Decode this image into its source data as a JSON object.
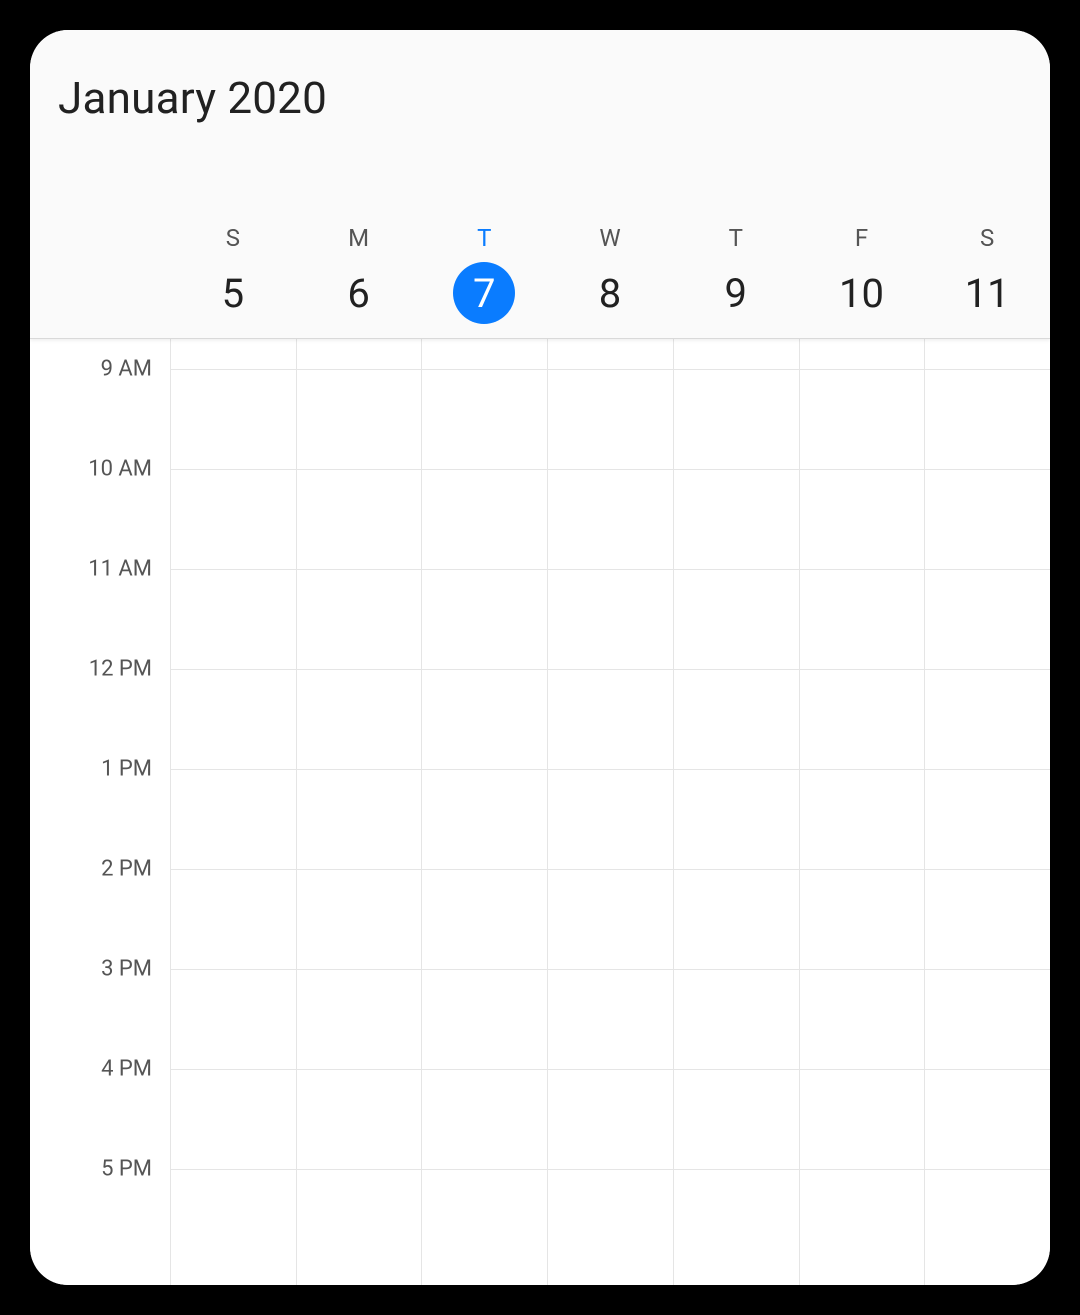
{
  "header": {
    "title": "January 2020"
  },
  "week": {
    "days": [
      {
        "dow": "S",
        "num": "5",
        "today": false
      },
      {
        "dow": "M",
        "num": "6",
        "today": false
      },
      {
        "dow": "T",
        "num": "7",
        "today": true
      },
      {
        "dow": "W",
        "num": "8",
        "today": false
      },
      {
        "dow": "T",
        "num": "9",
        "today": false
      },
      {
        "dow": "F",
        "num": "10",
        "today": false
      },
      {
        "dow": "S",
        "num": "11",
        "today": false
      }
    ]
  },
  "hours": [
    "9 AM",
    "10 AM",
    "11 AM",
    "12 PM",
    "1 PM",
    "2 PM",
    "3 PM",
    "4 PM",
    "5 PM"
  ],
  "colors": {
    "accent": "#0a7cff"
  }
}
